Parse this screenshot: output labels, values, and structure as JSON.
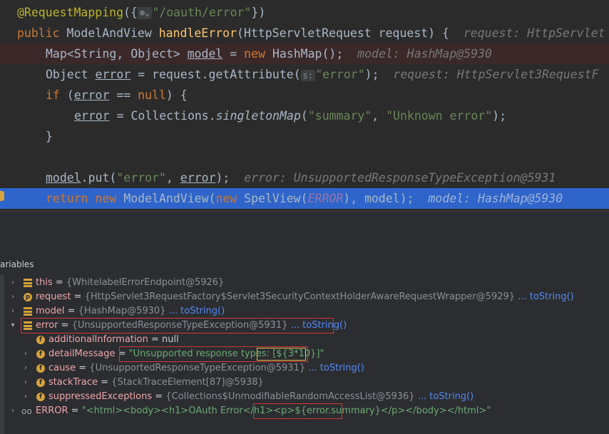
{
  "code": {
    "annotation": "@RequestMapping",
    "annotation_open": "({",
    "mapping_path": "\"/oauth/error\"",
    "annotation_close": "})",
    "l2_kw": "public",
    "l2_type": " ModelAndView ",
    "l2_fn": "handleError",
    "l2_params": "(HttpServletRequest request) {",
    "l2_hint": "request: HttpServlet",
    "l3_code_a": "Map<String, Object> ",
    "l3_var": "model",
    "l3_code_b": " = ",
    "l3_new": "new",
    "l3_code_c": " HashMap();",
    "l3_hint": "model: HashMap@5930",
    "l4_code_a": "Object ",
    "l4_var": "error",
    "l4_code_b": " = request.getAttribute(",
    "l4_param": "s:",
    "l4_str": "\"error\"",
    "l4_code_c": ");",
    "l4_hint": "request: HttpServlet3RequestF",
    "l5_kw": "if",
    "l5_code_a": " (",
    "l5_var": "error",
    "l5_code_b": " == ",
    "l5_null": "null",
    "l5_code_c": ") {",
    "l6_var": "error",
    "l6_code_a": " = Collections.",
    "l6_method": "singletonMap",
    "l6_code_b": "(",
    "l6_str1": "\"summary\"",
    "l6_comma": ", ",
    "l6_str2": "\"Unknown error\"",
    "l6_code_c": ");",
    "l7": "}",
    "l9_var": "model",
    "l9_code_a": ".put(",
    "l9_str": "\"error\"",
    "l9_code_b": ", ",
    "l9_var2": "error",
    "l9_code_c": ");",
    "l9_hint": "error: UnsupportedResponseTypeException@5931",
    "l10_kw": "return",
    "l10_sp": " ",
    "l10_new": "new",
    "l10_code_a": " ModelAndView(",
    "l10_new2": "new",
    "l10_code_b": " SpelView(",
    "l10_const": "ERROR",
    "l10_code_c": "), model);",
    "l10_hint": "model: HashMap@5930"
  },
  "panel": {
    "title": "ariables"
  },
  "variables": [
    {
      "name": "this",
      "eq": " = ",
      "value": "{WhitelabelErrorEndpoint@5926}",
      "link": ""
    },
    {
      "name": "request",
      "eq": " = ",
      "value": "{HttpServlet3RequestFactory$Servlet3SecurityContextHolderAwareRequestWrapper@5929}",
      "link": "... toString()"
    },
    {
      "name": "model",
      "eq": " = ",
      "value": "{HashMap@5930}",
      "link": "... toString()"
    },
    {
      "name": "error",
      "eq": " = ",
      "value": "{UnsupportedResponseTypeException@5931}",
      "link": "... toString()"
    },
    {
      "name": "additionalInformation",
      "eq": " = ",
      "value": "null",
      "link": ""
    },
    {
      "name": "detailMessage",
      "eq": " = ",
      "value": "\"Unsupported response types: [${3*10}]\"",
      "link": ""
    },
    {
      "name": "cause",
      "eq": " = ",
      "value": "{UnsupportedResponseTypeException@5931}",
      "link": "... toString()"
    },
    {
      "name": "stackTrace",
      "eq": " = ",
      "value": "{StackTraceElement[87]@5938}",
      "link": ""
    },
    {
      "name": "suppressedExceptions",
      "eq": " = ",
      "value": "{Collections$UnmodifiableRandomAccessList@5936}",
      "link": "... toString()"
    },
    {
      "name": "ERROR",
      "eq": " = ",
      "value": "\"<html><body><h1>OAuth Error</h1><p>${error.summary}</p></body></html>\"",
      "link": ""
    }
  ],
  "icons": {
    "field_letter": "f",
    "param_letter": "p",
    "watch_glyph": "oo",
    "globe_glyph": "⊕⌄",
    "expanded": "▾",
    "collapsed": "›"
  },
  "colors": {
    "highlight_line": "#2f65ca",
    "breakpoint_line": "#3b2829",
    "annotation_box": "#d13a3a",
    "yellow_box": "#e0c34a"
  }
}
